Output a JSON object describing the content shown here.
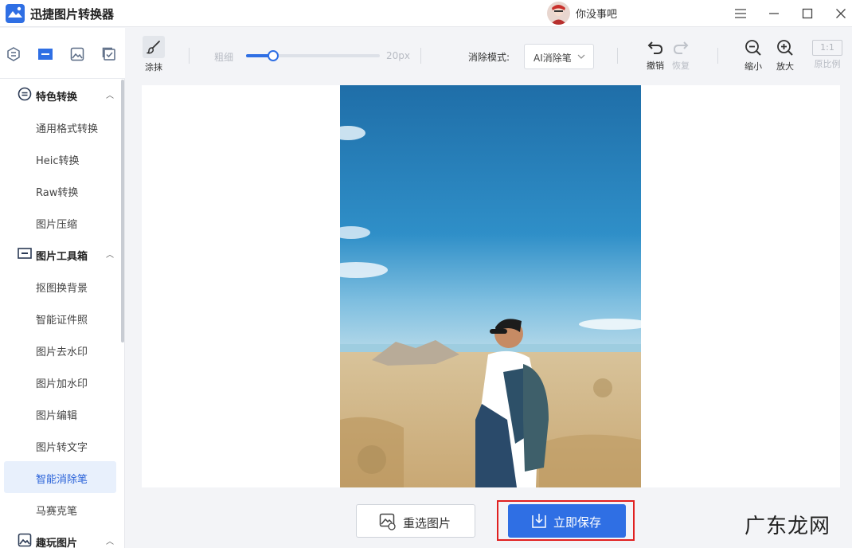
{
  "app": {
    "title": "迅捷图片转换器",
    "brand_color": "#2f6fe4"
  },
  "user": {
    "name": "你没事吧"
  },
  "window_controls": [
    "menu-icon",
    "minimize-icon",
    "maximize-icon",
    "close-icon"
  ],
  "icon_strip": [
    "convert-icon",
    "toolbox-icon",
    "image-icon",
    "check-icon"
  ],
  "sidebar": {
    "sections": [
      {
        "label": "特色转换",
        "items": [
          "通用格式转换",
          "Heic转换",
          "Raw转换",
          "图片压缩"
        ]
      },
      {
        "label": "图片工具箱",
        "items": [
          "抠图换背景",
          "智能证件照",
          "图片去水印",
          "图片加水印",
          "图片编辑",
          "图片转文字",
          "智能消除笔",
          "马赛克笔"
        ]
      },
      {
        "label": "趣玩图片",
        "items": []
      }
    ],
    "active_item": "智能消除笔"
  },
  "toolbar": {
    "smear_label": "涂抹",
    "thickness_label": "粗细",
    "thickness_value": "20px",
    "thickness_fraction": 0.2,
    "mode_label": "消除模式:",
    "mode_value": "AI消除笔",
    "undo_label": "撤销",
    "redo_label": "恢复",
    "zoom_out_label": "缩小",
    "zoom_in_label": "放大",
    "ratio_badge": "1:1",
    "original_ratio_label": "原比例"
  },
  "actions": {
    "reselect_label": "重选图片",
    "save_label": "立即保存"
  },
  "watermark": "广东龙网"
}
